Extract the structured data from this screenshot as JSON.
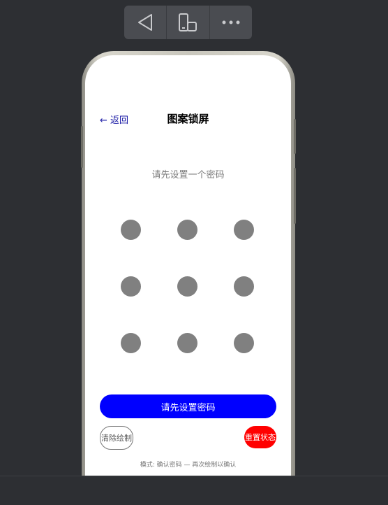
{
  "toolbar": {
    "buttons": [
      {
        "icon": "back-triangle-icon"
      },
      {
        "icon": "device-rotate-icon"
      },
      {
        "icon": "more-dots-icon"
      }
    ]
  },
  "screen": {
    "back_label": "← 返回",
    "title": "图案锁屏",
    "prompt": "请先设置一个密码",
    "primary_button": "请先设置密码",
    "clear_button": "清除绘制",
    "reset_button": "重置状态",
    "mode_text": "模式:  确认密码 — 再次绘制以确认"
  },
  "colors": {
    "dot": "#808080",
    "primary": "#0000ff",
    "reset": "#ff0000",
    "back_link": "#1a1aa6"
  }
}
